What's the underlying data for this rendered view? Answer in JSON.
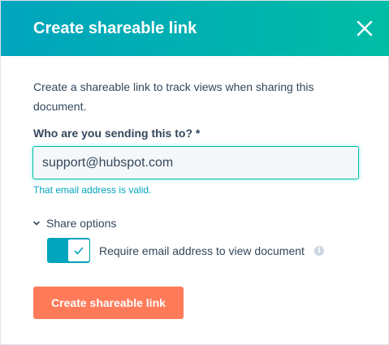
{
  "dialog": {
    "title": "Create shareable link",
    "close_icon": "close-icon",
    "description": "Create a shareable link to track views when sharing this document.",
    "recipient": {
      "label": "Who are you sending this to? *",
      "value": "support@hubspot.com",
      "validation_message": "That email address is valid."
    },
    "share_options": {
      "label": "Share options",
      "icon": "chevron-down-icon",
      "require_email": {
        "label": "Require email address to view document",
        "enabled": true,
        "info_icon": "info-icon"
      }
    },
    "primary_button": "Create shareable link"
  },
  "colors": {
    "header_start": "#00a4bd",
    "header_end": "#00bda5",
    "text": "#33475b",
    "valid": "#00a4bd",
    "primary": "#ff7a59",
    "toggle_on": "#00a4bd"
  }
}
